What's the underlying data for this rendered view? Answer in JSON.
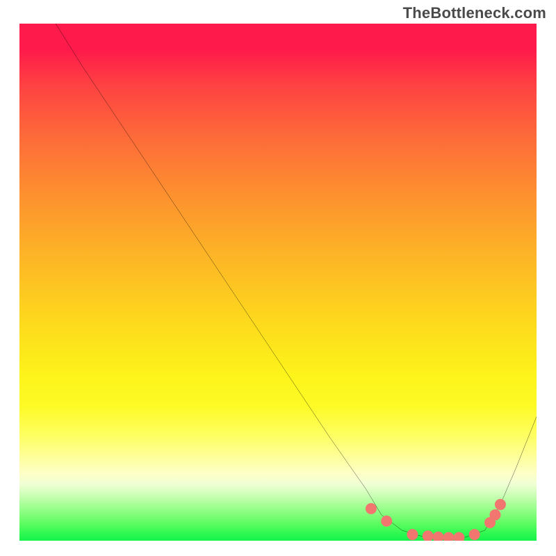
{
  "watermark": "TheBottleneck.com",
  "chart_data": {
    "type": "line",
    "title": "",
    "xlabel": "",
    "ylabel": "",
    "xlim": [
      0,
      100
    ],
    "ylim": [
      0,
      100
    ],
    "grid": false,
    "background_gradient": {
      "direction": "vertical",
      "stops": [
        {
          "pos": 0.0,
          "color": "#fe1a4a"
        },
        {
          "pos": 0.5,
          "color": "#fdc820"
        },
        {
          "pos": 0.8,
          "color": "#feff66"
        },
        {
          "pos": 1.0,
          "color": "#14f34c"
        }
      ]
    },
    "series": [
      {
        "name": "curve",
        "color": "#000000",
        "x": [
          7,
          12,
          20,
          30,
          40,
          50,
          60,
          67,
          70,
          74,
          78,
          82,
          86,
          90,
          93,
          96,
          100
        ],
        "y": [
          100,
          92,
          80,
          65,
          50,
          35,
          20,
          10,
          5,
          2,
          0.8,
          0.5,
          0.6,
          2,
          7,
          14,
          24
        ]
      }
    ],
    "markers": {
      "name": "dots",
      "color": "#f0766f",
      "radius_px": 8,
      "x": [
        68,
        71,
        76,
        79,
        81,
        83,
        85,
        88,
        91,
        92,
        93
      ],
      "y": [
        6.2,
        3.8,
        1.2,
        0.9,
        0.7,
        0.6,
        0.6,
        1.2,
        3.5,
        5.0,
        7.0
      ]
    }
  }
}
